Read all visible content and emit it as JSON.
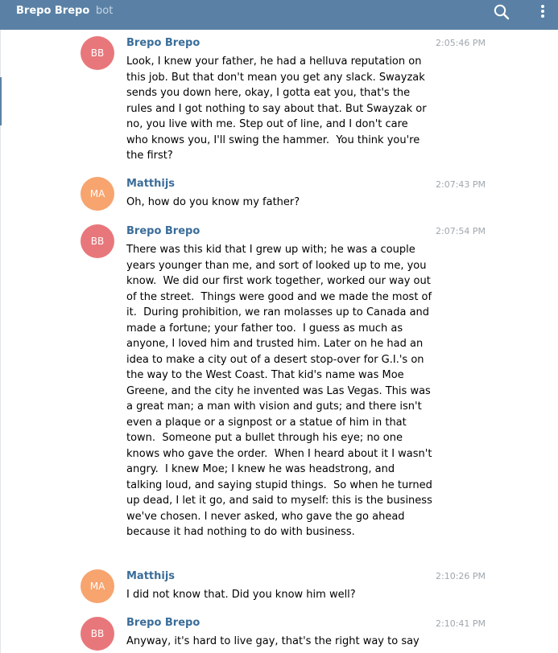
{
  "header": {
    "title": "Brepo Brepo",
    "subtitle": "bot",
    "search_icon": "search-icon",
    "more_icon": "more-vertical-icon"
  },
  "colors": {
    "header_bg": "#5a81a5",
    "name": "#3a6d99",
    "avatar_bb": "#e8777b",
    "avatar_ma": "#f7a46f"
  },
  "messages": [
    {
      "avatar": "BB",
      "name": "Brepo Brepo",
      "time": "2:05:46 PM",
      "text": "Look, I knew your father, he had a helluva reputation on this job. But that don't mean you get any slack. Swayzak sends you down here, okay, I gotta eat you, that's the rules and I got nothing to say about that. But Swayzak or no, you live with me. Step out of line, and I don't care who knows you, I'll swing the hammer.  You think you're the first?"
    },
    {
      "avatar": "MA",
      "name": "Matthijs",
      "time": "2:07:43 PM",
      "text": "Oh, how do you know my father?"
    },
    {
      "avatar": "BB",
      "name": "Brepo Brepo",
      "time": "2:07:54 PM",
      "text": "There was this kid that I grew up with; he was a couple years younger than me, and sort of looked up to me, you know.  We did our first work together, worked our way out of the street.  Things were good and we made the most of it.  During prohibition, we ran molasses up to Canada and made a fortune; your father too.  I guess as much as anyone, I loved him and trusted him. Later on he had an idea to make a city out of a desert stop-over for G.I.'s on the way to the West Coast. That kid's name was Moe Greene, and the city he invented was Las Vegas. This was a great man; a man with vision and guts; and there isn't even a plaque or a signpost or a statue of him in that town.  Someone put a bullet through his eye; no one knows who gave the order.  When I heard about it I wasn't angry.  I knew Moe; I knew he was headstrong, and talking loud, and saying stupid things.  So when he turned up dead, I let it go, and said to myself: this is the business we've chosen. I never asked, who gave the go ahead because it had nothing to do with business."
    },
    {
      "avatar": "MA",
      "name": "Matthijs",
      "time": "2:10:26 PM",
      "text": "I did not know that. Did you know him well?"
    },
    {
      "avatar": "BB",
      "name": "Brepo Brepo",
      "time": "2:10:41 PM",
      "text": "Anyway, it's hard to live gay, that's the right way to say"
    }
  ]
}
